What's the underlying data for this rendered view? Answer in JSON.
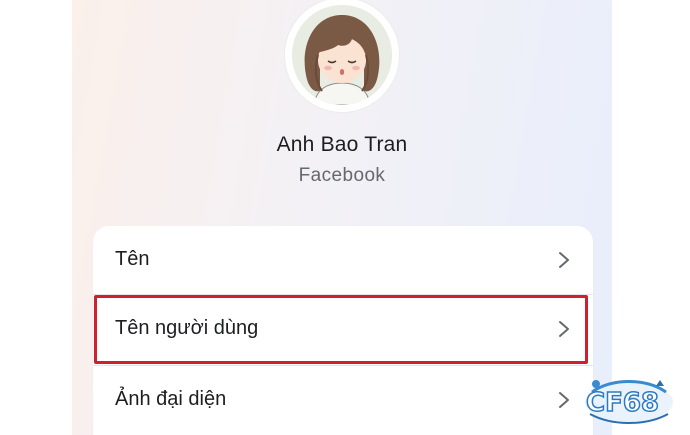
{
  "profile": {
    "name": "Anh Bao Tran",
    "source": "Facebook"
  },
  "menu": {
    "items": [
      {
        "label": "Tên"
      },
      {
        "label": "Tên người dùng",
        "highlighted": true
      },
      {
        "label": "Ảnh đại diện"
      }
    ]
  },
  "watermark": {
    "text": "CF68"
  },
  "colors": {
    "highlight": "#d0202e",
    "text_primary": "#1c1e21",
    "text_secondary": "#65686c"
  }
}
